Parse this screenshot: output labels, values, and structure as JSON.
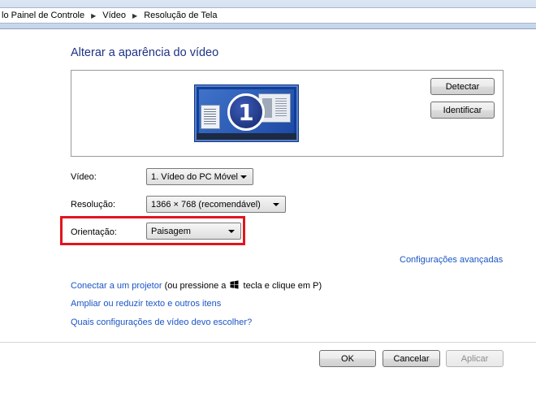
{
  "breadcrumb": [
    "lo Painel de Controle",
    "Vídeo",
    "Resolução de Tela"
  ],
  "page_title": "Alterar a aparência do vídeo",
  "preview": {
    "monitor_number": "1",
    "detect_label": "Detectar",
    "identify_label": "Identificar"
  },
  "form": {
    "video_label": "Vídeo:",
    "video_value": "1. Vídeo do PC Móvel",
    "resolution_label": "Resolução:",
    "resolution_value": "1366 × 768 (recomendável)",
    "orientation_label": "Orientação:",
    "orientation_value": "Paisagem"
  },
  "links": {
    "advanced": "Configurações avançadas",
    "projector_link": "Conectar a um projetor",
    "projector_text_before": "(ou pressione a",
    "projector_text_after": "tecla e clique em P)",
    "text_size": "Ampliar ou reduzir texto e outros itens",
    "which_settings": "Quais configurações de vídeo devo escolher?"
  },
  "footer": {
    "ok_label": "OK",
    "cancel_label": "Cancelar",
    "apply_label": "Aplicar"
  },
  "colors": {
    "title": "#1e3287",
    "link": "#1a55c6",
    "highlight": "#e3141e"
  }
}
